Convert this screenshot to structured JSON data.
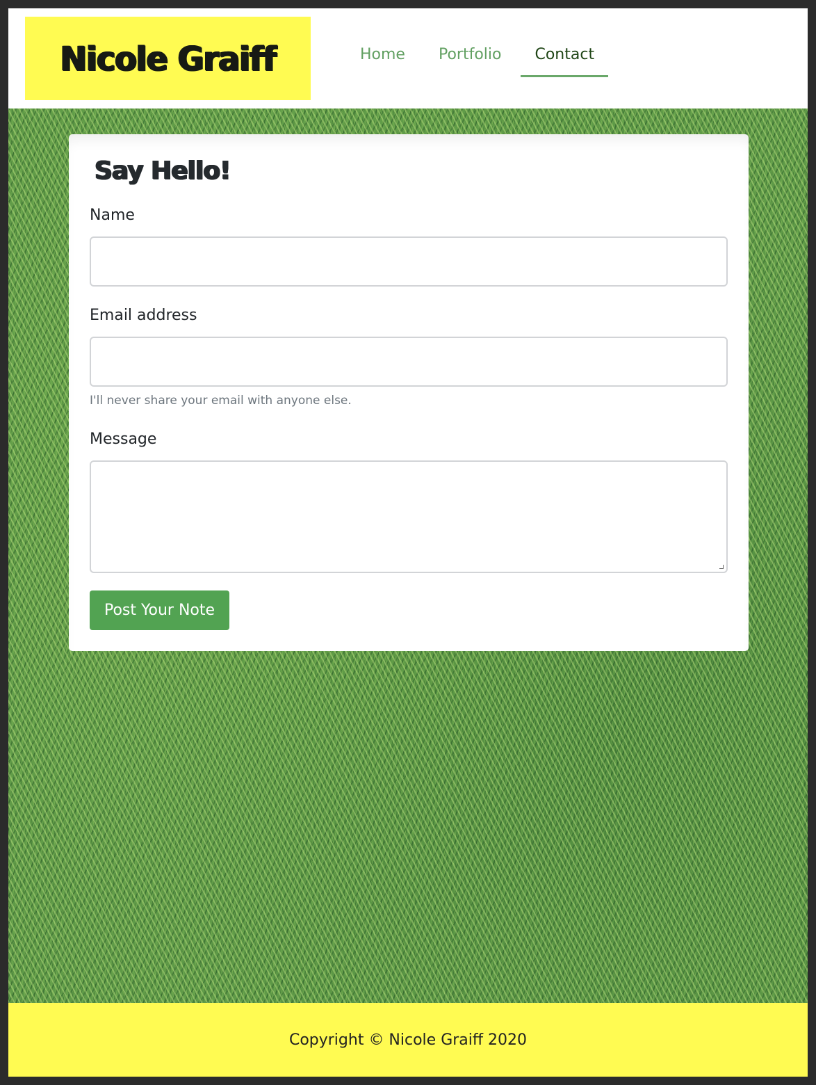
{
  "header": {
    "brand": "Nicole Graiff",
    "nav": [
      {
        "label": "Home"
      },
      {
        "label": "Portfolio"
      },
      {
        "label": "Contact"
      }
    ],
    "active_nav": "Contact"
  },
  "form": {
    "title": "Say Hello!",
    "name_label": "Name",
    "name_value": "",
    "email_label": "Email address",
    "email_value": "",
    "email_help": "I'll never share your email with anyone else.",
    "message_label": "Message",
    "message_value": "",
    "submit_label": "Post Your Note"
  },
  "footer": {
    "text": "Copyright © Nicole Graiff 2020"
  },
  "colors": {
    "brand_yellow": "#fffb52",
    "nav_green": "#62a062",
    "nav_active": "#1f4516",
    "button_green": "#52a352"
  }
}
